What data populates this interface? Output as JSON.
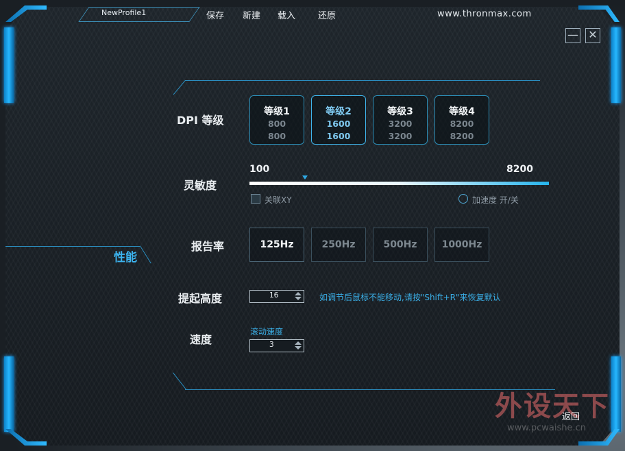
{
  "header": {
    "profile_name": "NewProfile1",
    "menu": [
      "保存",
      "新建",
      "载入",
      "还原"
    ],
    "site": "www.thronmax.com"
  },
  "window": {
    "minimize_glyph": "—",
    "close_glyph": "✕"
  },
  "section": "性能",
  "dpi": {
    "label": "DPI 等级",
    "levels": [
      {
        "name": "等级1",
        "x": "800",
        "y": "800",
        "active": false
      },
      {
        "name": "等级2",
        "x": "1600",
        "y": "1600",
        "active": true
      },
      {
        "name": "等级3",
        "x": "3200",
        "y": "3200",
        "active": false
      },
      {
        "name": "等级4",
        "x": "8200",
        "y": "8200",
        "active": false
      }
    ]
  },
  "sensitivity": {
    "label": "灵敏度",
    "min": "100",
    "max": "8200",
    "value": 1600,
    "link_xy_label": "关联XY",
    "accel_label": "加速度 开/关"
  },
  "report_rate": {
    "label": "报告率",
    "options": [
      "125Hz",
      "250Hz",
      "500Hz",
      "1000Hz"
    ],
    "selected": "125Hz"
  },
  "lift": {
    "label": "提起高度",
    "value": "16",
    "hint": "如调节后鼠标不能移动,请按\"Shift+R\"来恢复默认"
  },
  "speed": {
    "label": "速度",
    "scroll_label": "滚动速度",
    "value": "3"
  },
  "footer": {
    "return_label": "返回"
  },
  "watermark": {
    "big": "外设天下",
    "small": "www.pcwaishe.cn"
  },
  "colors": {
    "accent": "#2ea8e4",
    "frame": "#1ea6ff"
  }
}
